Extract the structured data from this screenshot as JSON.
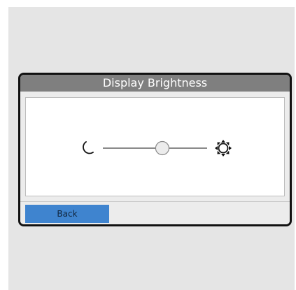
{
  "dialog": {
    "title": "Display Brightness"
  },
  "brightness": {
    "level": 0.57,
    "min_icon": "moon-icon",
    "max_icon": "sun-icon"
  },
  "footer": {
    "back_label": "Back"
  },
  "colors": {
    "title_bar": "#7f7f7f",
    "back_button": "#3f84cf",
    "frame": "#111111",
    "track": "#8a8a8a",
    "thumb_fill": "#ececec"
  }
}
